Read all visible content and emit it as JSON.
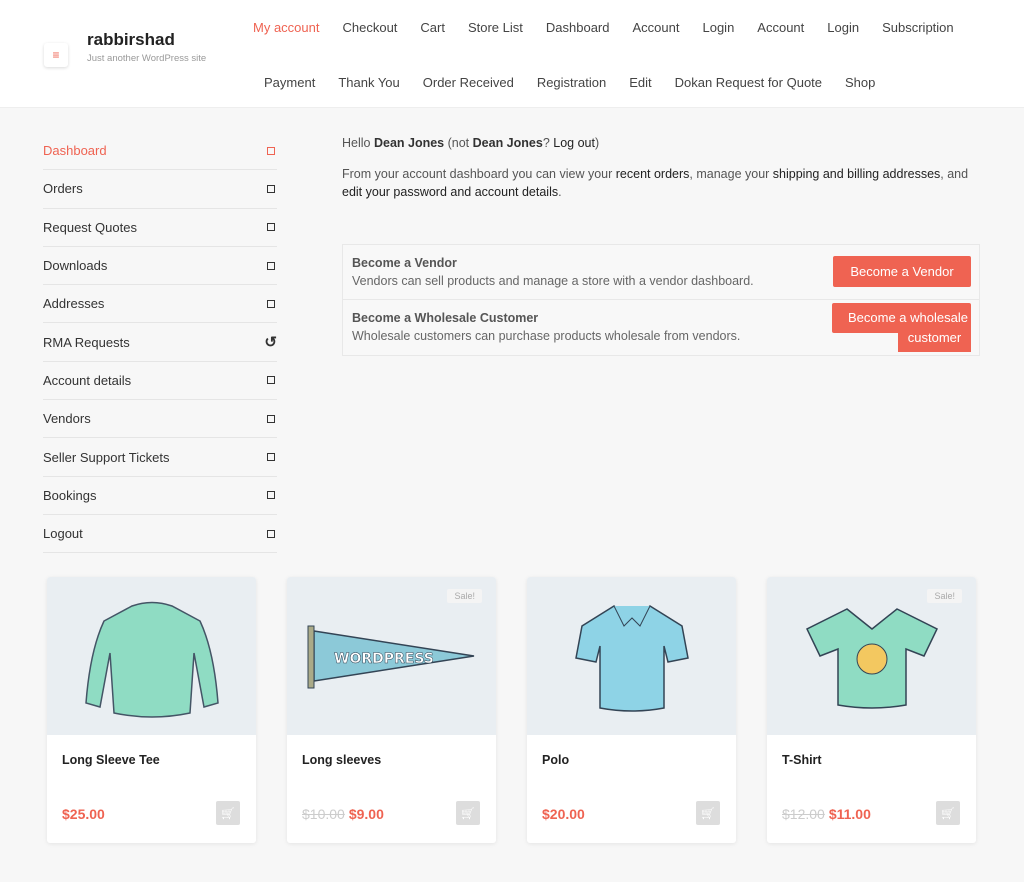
{
  "site": {
    "title": "rabbirshad",
    "tagline": "Just another WordPress site"
  },
  "nav": {
    "row1": [
      "My account",
      "Checkout",
      "Cart",
      "Store List",
      "Dashboard",
      "Account",
      "Login",
      "Account",
      "Login",
      "Subscription"
    ],
    "row2": [
      "Payment",
      "Thank You",
      "Order Received",
      "Registration",
      "Edit",
      "Dokan Request for Quote",
      "Shop"
    ]
  },
  "sidebar": [
    "Dashboard",
    "Orders",
    "Request Quotes",
    "Downloads",
    "Addresses",
    "RMA Requests",
    "Account details",
    "Vendors",
    "Seller Support Tickets",
    "Bookings",
    "Logout"
  ],
  "greeting": {
    "hello": "Hello ",
    "name": "Dean Jones",
    "not": " (not ",
    "name2": "Dean Jones",
    "q": "? ",
    "logout": "Log out",
    "close": ")"
  },
  "intro": {
    "t1": "From your account dashboard you can view your ",
    "l1": "recent orders",
    "t2": ", manage your ",
    "l2": "shipping and billing addresses",
    "t3": ", and ",
    "l3": "edit your password and account details",
    "t4": "."
  },
  "vendor": {
    "title": "Become a Vendor",
    "desc": "Vendors can sell products and manage a store with a vendor dashboard.",
    "button": "Become a Vendor"
  },
  "wholesale": {
    "title": "Become a Wholesale Customer",
    "desc": "Wholesale customers can purchase products wholesale from vendors.",
    "button1": "Become a wholesale",
    "button2": "customer"
  },
  "products": [
    {
      "name": "Long Sleeve Tee",
      "price": "$25.00",
      "old": "",
      "sale": ""
    },
    {
      "name": "Long sleeves",
      "price": "$9.00",
      "old": "$10.00",
      "sale": "Sale!"
    },
    {
      "name": "Polo",
      "price": "$20.00",
      "old": "",
      "sale": ""
    },
    {
      "name": "T-Shirt",
      "price": "$11.00",
      "old": "$12.00",
      "sale": "Sale!"
    }
  ],
  "colors": {
    "accent": "#ef6352"
  }
}
